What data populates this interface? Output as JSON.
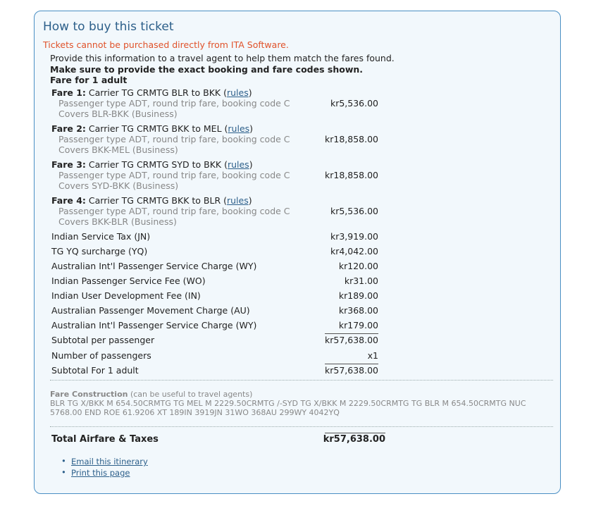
{
  "title": "How to buy this ticket",
  "warning": "Tickets cannot be purchased directly from ITA Software.",
  "intro": {
    "line1": "Provide this information to a travel agent to help them match the fares found.",
    "line2": "Make sure to provide the exact booking and fare codes shown.",
    "line3": "Fare for 1 adult"
  },
  "fares": [
    {
      "label": "Fare 1:",
      "desc": "Carrier TG CRMTG BLR to BKK",
      "rules": "rules",
      "passenger": "Passenger type ADT, round trip fare, booking code C",
      "covers": "Covers BLR-BKK (Business)",
      "amount": "kr5,536.00"
    },
    {
      "label": "Fare 2:",
      "desc": "Carrier TG CRMTG BKK to MEL",
      "rules": "rules",
      "passenger": "Passenger type ADT, round trip fare, booking code C",
      "covers": "Covers BKK-MEL (Business)",
      "amount": "kr18,858.00"
    },
    {
      "label": "Fare 3:",
      "desc": "Carrier TG CRMTG SYD to BKK",
      "rules": "rules",
      "passenger": "Passenger type ADT, round trip fare, booking code C",
      "covers": "Covers SYD-BKK (Business)",
      "amount": "kr18,858.00"
    },
    {
      "label": "Fare 4:",
      "desc": "Carrier TG CRMTG BKK to BLR",
      "rules": "rules",
      "passenger": "Passenger type ADT, round trip fare, booking code C",
      "covers": "Covers BKK-BLR (Business)",
      "amount": "kr5,536.00"
    }
  ],
  "taxes": [
    {
      "label": "Indian Service Tax (JN)",
      "amount": "kr3,919.00"
    },
    {
      "label": "TG YQ surcharge (YQ)",
      "amount": "kr4,042.00"
    },
    {
      "label": "Australian Int'l Passenger Service Charge (WY)",
      "amount": "kr120.00"
    },
    {
      "label": "Indian Passenger Service Fee (WO)",
      "amount": "kr31.00"
    },
    {
      "label": "Indian User Development Fee (IN)",
      "amount": "kr189.00"
    },
    {
      "label": "Australian Passenger Movement Charge (AU)",
      "amount": "kr368.00"
    },
    {
      "label": "Australian Int'l Passenger Service Charge (WY)",
      "amount": "kr179.00"
    }
  ],
  "subtotal_per_passenger": {
    "label": "Subtotal per passenger",
    "amount": "kr57,638.00"
  },
  "num_passengers": {
    "label": "Number of passengers",
    "value": "x1"
  },
  "subtotal_adult": {
    "label": "Subtotal For 1 adult",
    "amount": "kr57,638.00"
  },
  "fare_construction": {
    "heading": "Fare Construction",
    "note": "(can be useful to travel agents)",
    "text": "BLR TG X/BKK M 654.50CRMTG TG MEL M 2229.50CRMTG /-SYD TG X/BKK M 2229.50CRMTG TG BLR M 654.50CRMTG NUC 5768.00 END ROE 61.9206 XT 189IN 3919JN 31WO 368AU 299WY 4042YQ"
  },
  "total": {
    "label": "Total Airfare & Taxes",
    "amount": "kr57,638.00"
  },
  "links": {
    "email": "Email this itinerary",
    "print": "Print this page"
  }
}
